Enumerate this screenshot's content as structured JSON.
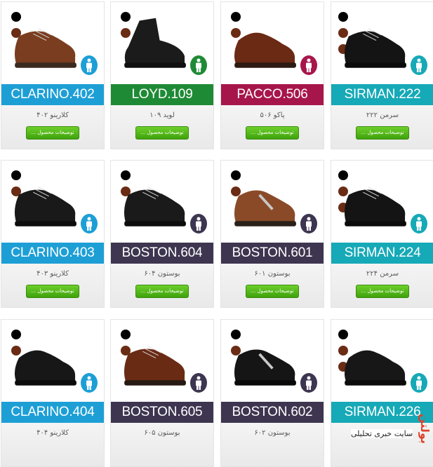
{
  "products": [
    {
      "model": "CLARINO.402",
      "name_fa": "کلارینو ۴۰۲",
      "button": "توضیحات محصول ...",
      "band_color": "#1d9fd6",
      "icon_color": "#1d9fd6",
      "dots": [
        "black",
        "brown"
      ],
      "shoe": "brown-oxford"
    },
    {
      "model": "LOYD.109",
      "name_fa": "لوید ۱۰۹",
      "button": "توضیحات محصول ...",
      "band_color": "#1f8a36",
      "icon_color": "#1f8a36",
      "dots": [
        "black",
        "brown"
      ],
      "shoe": "black-boot"
    },
    {
      "model": "PACCO.506",
      "name_fa": "پاکو ۵۰۶",
      "button": "توضیحات محصول ...",
      "band_color": "#a7164b",
      "icon_color": "#a7164b",
      "dots": [
        "black",
        "brown"
      ],
      "shoe": "brown-loafer"
    },
    {
      "model": "SIRMAN.222",
      "name_fa": "سرمن ۲۲۲",
      "button": "توضیحات محصول ...",
      "band_color": "#16a9b7",
      "icon_color": "#16a9b7",
      "dots": [
        "black",
        "brown",
        "brown"
      ],
      "shoe": "black-derby"
    },
    {
      "model": "CLARINO.403",
      "name_fa": "کلارینو ۴۰۳",
      "button": "توضیحات محصول ...",
      "band_color": "#1d9fd6",
      "icon_color": "#1d9fd6",
      "dots": [
        "black",
        "brown"
      ],
      "shoe": "black-oxford"
    },
    {
      "model": "BOSTON.604",
      "name_fa": "بوستون ۶۰۴",
      "button": "توضیحات محصول ...",
      "band_color": "#3e3550",
      "icon_color": "#3e3550",
      "dots": [
        "black",
        "brown"
      ],
      "shoe": "black-lace"
    },
    {
      "model": "BOSTON.601",
      "name_fa": "بوستون ۶۰۱",
      "button": "توضیحات محصول ...",
      "band_color": "#3e3550",
      "icon_color": "#3e3550",
      "dots": [
        "black",
        "brown"
      ],
      "shoe": "brown-sport"
    },
    {
      "model": "SIRMAN.224",
      "name_fa": "سرمن ۲۲۴",
      "button": "توضیحات محصول ...",
      "band_color": "#16a9b7",
      "icon_color": "#16a9b7",
      "dots": [
        "black",
        "brown",
        "brown"
      ],
      "shoe": "black-derby"
    },
    {
      "model": "CLARINO.404",
      "name_fa": "کلارینو ۴۰۴",
      "button": "",
      "band_color": "#1d9fd6",
      "icon_color": "#1d9fd6",
      "dots": [
        "black",
        "brown"
      ],
      "shoe": "black-slipon"
    },
    {
      "model": "BOSTON.605",
      "name_fa": "بوستون ۶۰۵",
      "button": "",
      "band_color": "#3e3550",
      "icon_color": "#3e3550",
      "dots": [
        "black",
        "brown"
      ],
      "shoe": "brown-lace"
    },
    {
      "model": "BOSTON.602",
      "name_fa": "بوستون ۶۰۲",
      "button": "",
      "band_color": "#3e3550",
      "icon_color": "#3e3550",
      "dots": [
        "black",
        "brown"
      ],
      "shoe": "black-sport"
    },
    {
      "model": "SIRMAN.226",
      "name_fa": "",
      "button": "",
      "band_color": "#16a9b7",
      "icon_color": "#16a9b7",
      "dots": [
        "black",
        "brown",
        "brown"
      ],
      "shoe": "black-slipon"
    }
  ],
  "watermark": {
    "logo": "بولتن",
    "text": "سایت خبری تحلیلی"
  }
}
